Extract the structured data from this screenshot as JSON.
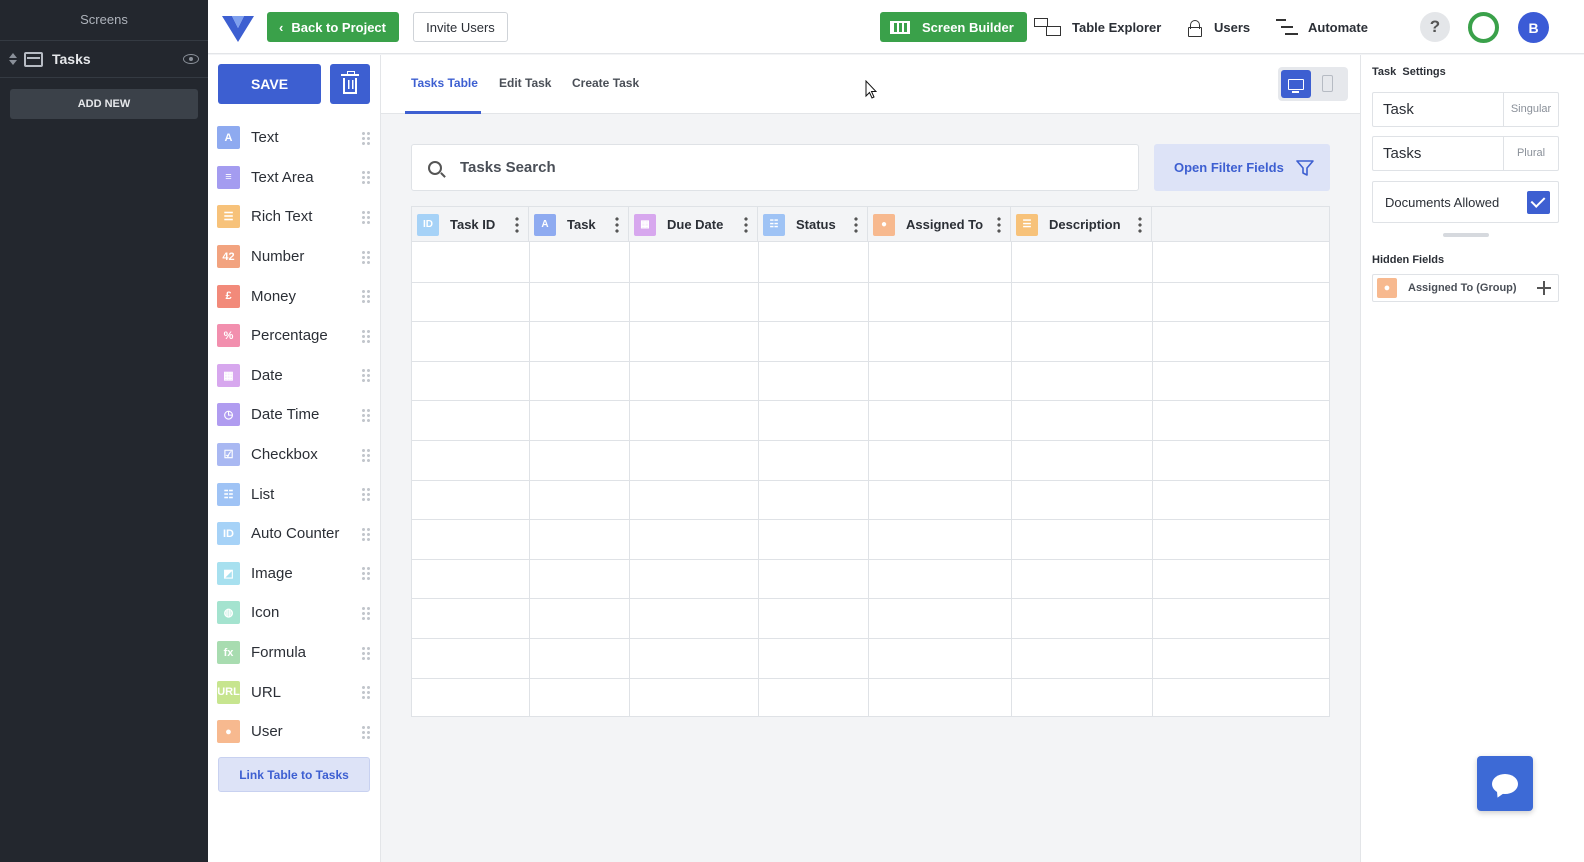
{
  "screens_panel": {
    "title": "Screens",
    "screen_item": {
      "label": "Tasks",
      "icon": "screen-icon"
    },
    "add_new_label": "ADD NEW"
  },
  "topbar": {
    "back_label": "Back to Project",
    "invite_label": "Invite Users",
    "nav": {
      "screen_builder": "Screen Builder",
      "table_explorer": "Table Explorer",
      "users": "Users",
      "automate": "Automate"
    },
    "help_label": "?",
    "avatar_initial": "B",
    "colors": {
      "green": "#3aa14a",
      "blue": "#3d5fd1"
    }
  },
  "fields_panel": {
    "save_label": "SAVE",
    "fields": [
      {
        "label": "Text",
        "badge": "A",
        "color": "#8eaaf0"
      },
      {
        "label": "Text Area",
        "badge": "≡",
        "color": "#a49cf0"
      },
      {
        "label": "Rich Text",
        "badge": "☰",
        "color": "#f7c27a"
      },
      {
        "label": "Number",
        "badge": "42",
        "color": "#f2a37f"
      },
      {
        "label": "Money",
        "badge": "£",
        "color": "#f28a7a"
      },
      {
        "label": "Percentage",
        "badge": "%",
        "color": "#f28fae"
      },
      {
        "label": "Date",
        "badge": "▦",
        "color": "#d7a7ee"
      },
      {
        "label": "Date Time",
        "badge": "◷",
        "color": "#b09cf0"
      },
      {
        "label": "Checkbox",
        "badge": "☑",
        "color": "#a9b8f2"
      },
      {
        "label": "List",
        "badge": "☷",
        "color": "#9fc3f5"
      },
      {
        "label": "Auto Counter",
        "badge": "ID",
        "color": "#a6d2f7"
      },
      {
        "label": "Image",
        "badge": "◩",
        "color": "#a7e0ef"
      },
      {
        "label": "Icon",
        "badge": "◍",
        "color": "#a4e3cf"
      },
      {
        "label": "Formula",
        "badge": "fx",
        "color": "#a8dcb0"
      },
      {
        "label": "URL",
        "badge": "URL",
        "color": "#c7e58f"
      },
      {
        "label": "User",
        "badge": "●",
        "color": "#f7b98f"
      }
    ],
    "link_table_label": "Link Table to Tasks"
  },
  "main": {
    "tabs": [
      {
        "label": "Tasks Table",
        "active": true
      },
      {
        "label": "Edit Task",
        "active": false
      },
      {
        "label": "Create Task",
        "active": false
      }
    ],
    "search_placeholder": "Tasks Search",
    "filter_label": "Open Filter Fields",
    "columns": [
      {
        "label": "Task ID",
        "badge": "ID",
        "color": "#a6d2f7"
      },
      {
        "label": "Task",
        "badge": "A",
        "color": "#8eaaf0"
      },
      {
        "label": "Due Date",
        "badge": "▦",
        "color": "#d7a7ee"
      },
      {
        "label": "Status",
        "badge": "☷",
        "color": "#9fc3f5"
      },
      {
        "label": "Assigned To",
        "badge": "●",
        "color": "#f7b98f"
      },
      {
        "label": "Description",
        "badge": "☰",
        "color": "#f7c27a"
      }
    ]
  },
  "settings": {
    "title": "Task  Settings",
    "singular_value": "Task",
    "singular_suffix": "Singular",
    "plural_value": "Tasks",
    "plural_suffix": "Plural",
    "documents_label": "Documents Allowed",
    "documents_checked": true,
    "hidden_title": "Hidden Fields",
    "hidden_fields": [
      {
        "label": "Assigned To (Group)",
        "badge": "●",
        "color": "#f7b98f"
      }
    ]
  }
}
